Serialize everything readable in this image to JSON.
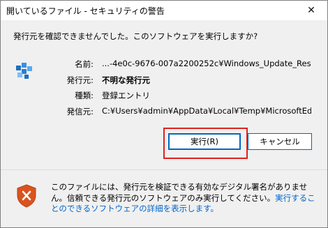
{
  "window": {
    "title": "開いているファイル - セキュリティの警告",
    "close_glyph": "✕"
  },
  "dialog": {
    "question": "発行元を確認できませんでした。このソフトウェアを実行しますか?",
    "file_icon": "registry-file-icon",
    "fields": {
      "name_label": "名前:",
      "name_value": "...-4e0c-9676-007a2200252c¥Windows_Update_Reset.reg",
      "publisher_label": "発行元:",
      "publisher_value": "不明な発行元",
      "type_label": "種類:",
      "type_value": "登録エントリ",
      "from_label": "発信元:",
      "from_value": "C:¥Users¥admin¥AppData¥Local¥Temp¥MicrosoftEdge..."
    },
    "buttons": {
      "run_label": "実行(R)",
      "cancel_label": "キャンセル"
    }
  },
  "footer": {
    "shield_icon": "shield-warning-icon",
    "text": "このファイルには、発行元を検証できる有効なデジタル署名がありません。信頼できる発行元のソフトウェアのみ実行してください。",
    "link": "実行することのできるソフトウェアの詳細を表示します。"
  },
  "colors": {
    "accent": "#0067c0",
    "highlight": "#e02020",
    "link": "#0066cc",
    "shield": "#d9531e"
  }
}
